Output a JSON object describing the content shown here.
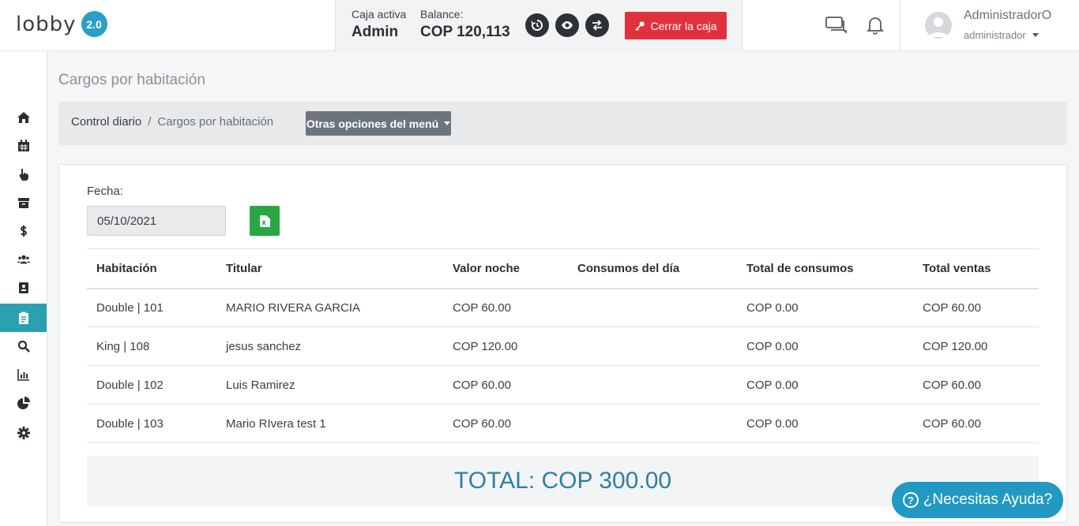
{
  "brand": {
    "logo_text": "lobby",
    "version": "2.0"
  },
  "cashbox": {
    "active_label": "Caja activa",
    "active_value": "Admin",
    "balance_label": "Balance:",
    "balance_value": "COP 120,113",
    "close_label": "Cerrar la caja"
  },
  "user": {
    "name": "AdministradorO",
    "role": "administrador"
  },
  "sidebar": {
    "items": [
      {
        "icon": "home-icon"
      },
      {
        "icon": "calendar-icon"
      },
      {
        "icon": "hand-pointer-icon"
      },
      {
        "icon": "archive-icon"
      },
      {
        "icon": "dollar-icon"
      },
      {
        "icon": "users-icon"
      },
      {
        "icon": "address-book-icon"
      },
      {
        "icon": "clipboard-icon",
        "active": true
      },
      {
        "icon": "search-icon"
      },
      {
        "icon": "bar-chart-icon"
      },
      {
        "icon": "pie-chart-icon"
      },
      {
        "icon": "gear-icon"
      }
    ]
  },
  "page": {
    "title": "Cargos por habitación",
    "breadcrumb": {
      "parent": "Control diario",
      "separator": "/",
      "current": "Cargos por habitación"
    },
    "menu_button": "Otras opciones del menú"
  },
  "filter": {
    "date_label": "Fecha:",
    "date_value": "05/10/2021"
  },
  "table": {
    "headers": [
      "Habitación",
      "Titular",
      "Valor noche",
      "Consumos del día",
      "Total de consumos",
      "Total ventas"
    ],
    "rows": [
      [
        "Double | 101",
        "MARIO RIVERA GARCIA",
        "COP 60.00",
        "",
        "COP 0.00",
        "COP 60.00"
      ],
      [
        "King | 108",
        "jesus sanchez",
        "COP 120.00",
        "",
        "COP 0.00",
        "COP 120.00"
      ],
      [
        "Double | 102",
        "Luis Ramirez",
        "COP 60.00",
        "",
        "COP 0.00",
        "COP 60.00"
      ],
      [
        "Double | 103",
        "Mario RIvera test 1",
        "COP 60.00",
        "",
        "COP 0.00",
        "COP 60.00"
      ]
    ]
  },
  "total": "TOTAL: COP 300.00",
  "help": {
    "label": "¿Necesitas Ayuda?"
  },
  "colors": {
    "accent": "#2aa0b0",
    "danger": "#e0323e",
    "success": "#28a745",
    "help": "#2199c2"
  }
}
